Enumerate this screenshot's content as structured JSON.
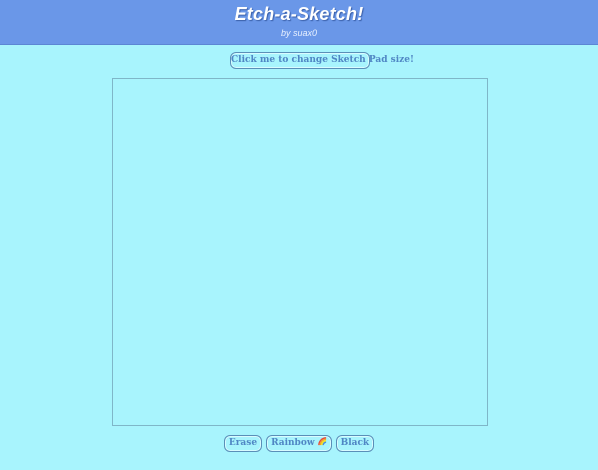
{
  "header": {
    "title": "Etch-a-Sketch!",
    "subtitle": "by suax0"
  },
  "size_button": {
    "label": "Click me to change Sketch Pad size!"
  },
  "controls": {
    "erase_label": "Erase",
    "rainbow_label": "Rainbow",
    "rainbow_icon": "rainbow-icon",
    "black_label": "Black"
  },
  "colors": {
    "background": "#a8f4fd",
    "header": "#6a97e8",
    "button_text": "#4f86c4",
    "pad_border": "#7fb6c8"
  }
}
